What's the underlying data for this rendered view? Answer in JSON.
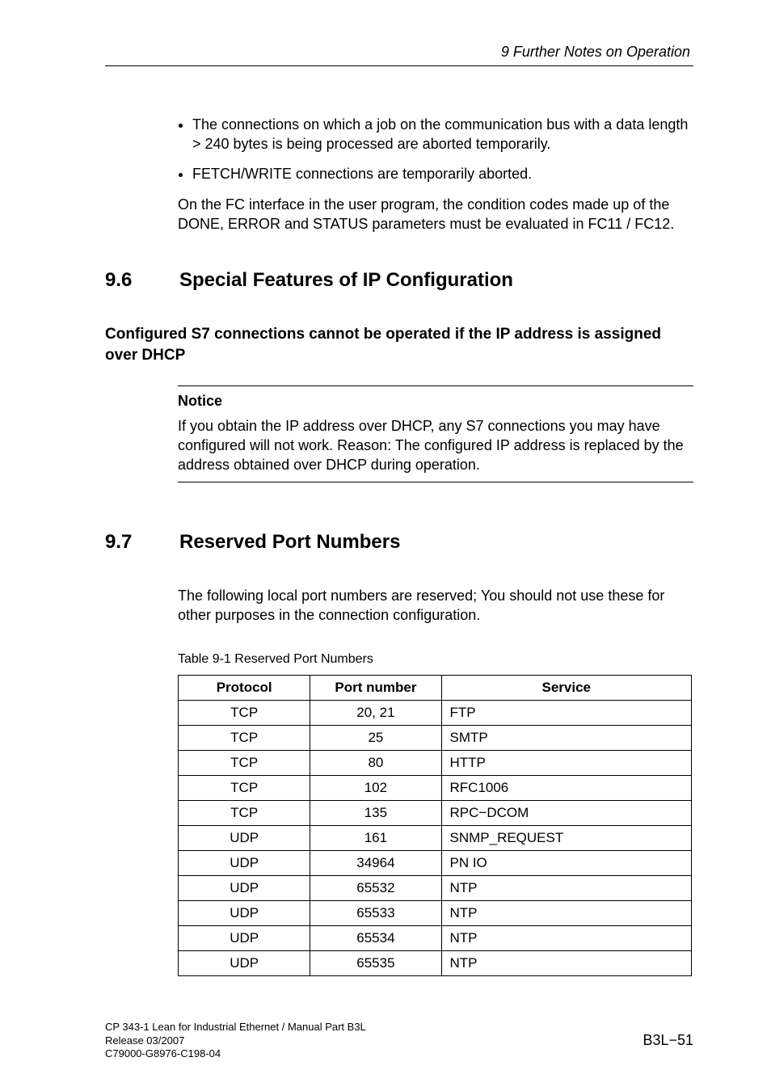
{
  "runningHead": "9   Further Notes on Operation",
  "intro": {
    "bullets": [
      "The connections on which a job on the communication bus with a data length > 240 bytes is being processed are aborted temporarily.",
      "FETCH/WRITE connections are temporarily aborted."
    ],
    "para": "On the FC interface in the user program, the condition codes made up of the DONE, ERROR and STATUS parameters must be evaluated in FC11 / FC12."
  },
  "section96": {
    "num": "9.6",
    "title": "Special Features of IP Configuration",
    "subhead": "Configured S7 connections cannot be operated if the IP address is assigned over DHCP",
    "noticeLabel": "Notice",
    "noticeText": "If you obtain the IP address over DHCP, any S7 connections you may have configured will not work. Reason: The configured IP address is replaced by the address obtained over DHCP during operation."
  },
  "section97": {
    "num": "9.7",
    "title": "Reserved Port Numbers",
    "para": "The following local port numbers are reserved; You should not use these for other purposes in the connection configuration.",
    "tableCaption": "Table 9-1    Reserved Port Numbers",
    "headers": {
      "protocol": "Protocol",
      "port": "Port number",
      "service": "Service"
    },
    "rows": [
      {
        "protocol": "TCP",
        "port": "20, 21",
        "service": "FTP"
      },
      {
        "protocol": "TCP",
        "port": "25",
        "service": "SMTP"
      },
      {
        "protocol": "TCP",
        "port": "80",
        "service": "HTTP"
      },
      {
        "protocol": "TCP",
        "port": "102",
        "service": "RFC1006"
      },
      {
        "protocol": "TCP",
        "port": "135",
        "service": "RPC−DCOM"
      },
      {
        "protocol": "UDP",
        "port": "161",
        "service": "SNMP_REQUEST"
      },
      {
        "protocol": "UDP",
        "port": "34964",
        "service": "PN IO"
      },
      {
        "protocol": "UDP",
        "port": "65532",
        "service": "NTP"
      },
      {
        "protocol": "UDP",
        "port": "65533",
        "service": "NTP"
      },
      {
        "protocol": "UDP",
        "port": "65534",
        "service": "NTP"
      },
      {
        "protocol": "UDP",
        "port": "65535",
        "service": "NTP"
      }
    ]
  },
  "footer": {
    "line1": "CP 343-1 Lean for Industrial Ethernet / Manual Part B3L",
    "line2": "Release 03/2007",
    "line3": "C79000-G8976-C198-04",
    "pageNum": "B3L−51"
  }
}
